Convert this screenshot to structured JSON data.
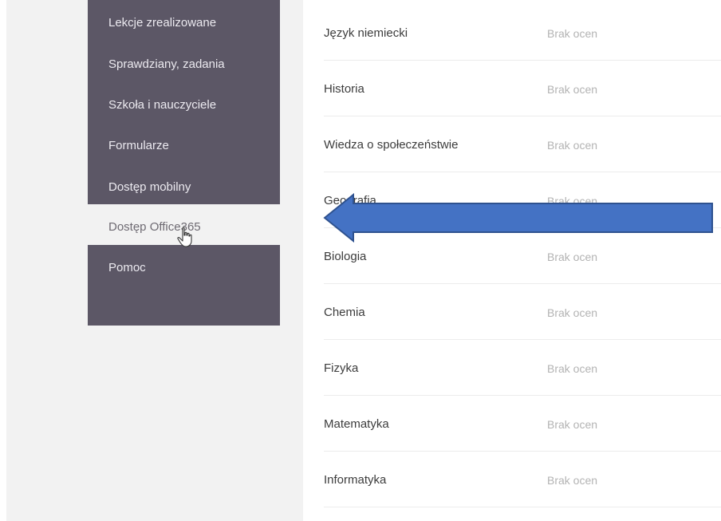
{
  "sidebar": {
    "items": [
      {
        "label": "Lekcje zrealizowane"
      },
      {
        "label": "Sprawdziany, zadania"
      },
      {
        "label": "Szkoła i nauczyciele"
      },
      {
        "label": "Formularze"
      },
      {
        "label": "Dostęp mobilny"
      },
      {
        "label": "Dostęp Office365"
      },
      {
        "label": "Pomoc"
      }
    ]
  },
  "grades": {
    "rows": [
      {
        "subject": "Język niemiecki",
        "grade": "Brak ocen"
      },
      {
        "subject": "Historia",
        "grade": "Brak ocen"
      },
      {
        "subject": "Wiedza o społeczeństwie",
        "grade": "Brak ocen"
      },
      {
        "subject": "Geografia",
        "grade": "Brak ocen"
      },
      {
        "subject": "Biologia",
        "grade": "Brak ocen"
      },
      {
        "subject": "Chemia",
        "grade": "Brak ocen"
      },
      {
        "subject": "Fizyka",
        "grade": "Brak ocen"
      },
      {
        "subject": "Matematyka",
        "grade": "Brak ocen"
      },
      {
        "subject": "Informatyka",
        "grade": "Brak ocen"
      }
    ]
  },
  "colors": {
    "menu_background": "#5c5766",
    "arrow_fill": "#4472c4",
    "arrow_stroke": "#2f528f"
  }
}
